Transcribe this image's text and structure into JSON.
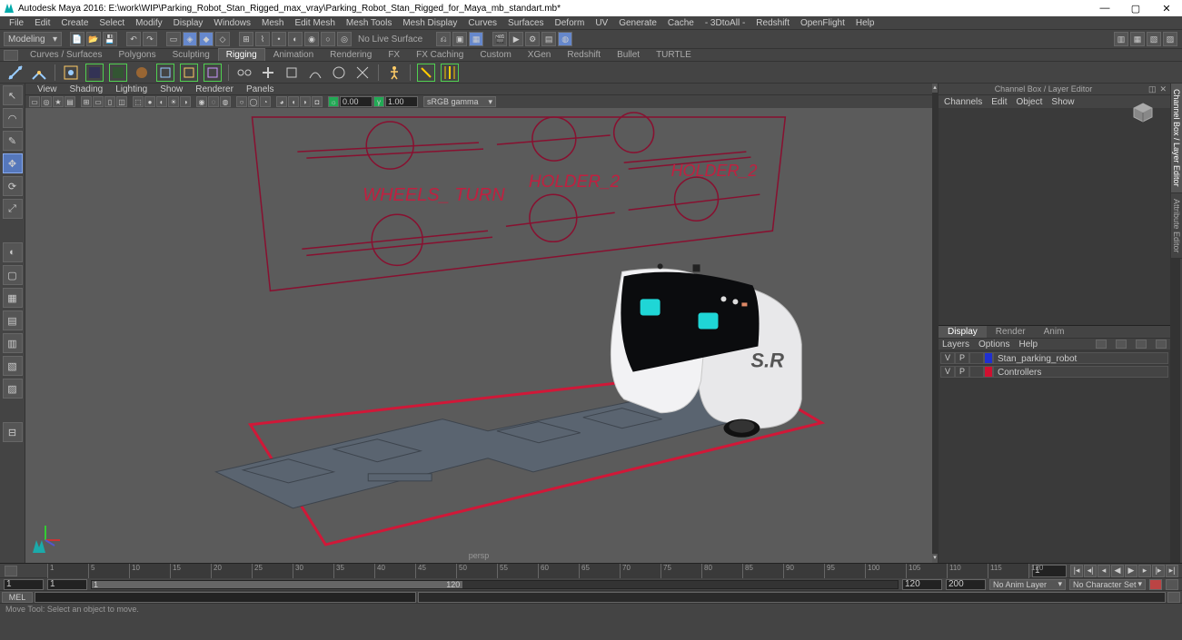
{
  "app": {
    "title": "Autodesk Maya 2016: E:\\work\\WIP\\Parking_Robot_Stan_Rigged_max_vray\\Parking_Robot_Stan_Rigged_for_Maya_mb_standart.mb*"
  },
  "mainmenu": [
    "File",
    "Edit",
    "Create",
    "Select",
    "Modify",
    "Display",
    "Windows",
    "Mesh",
    "Edit Mesh",
    "Mesh Tools",
    "Mesh Display",
    "Curves",
    "Surfaces",
    "Deform",
    "UV",
    "Generate",
    "Cache",
    "- 3DtoAll -",
    "Redshift",
    "OpenFlight",
    "Help"
  ],
  "workspace": {
    "selected": "Modeling"
  },
  "statusline": {
    "no_live_surface": "No Live Surface"
  },
  "shelf_tabs": [
    "Curves / Surfaces",
    "Polygons",
    "Sculpting",
    "Rigging",
    "Animation",
    "Rendering",
    "FX",
    "FX Caching",
    "Custom",
    "XGen",
    "Redshift",
    "Bullet",
    "TURTLE"
  ],
  "shelf_active": "Rigging",
  "view": {
    "menus": [
      "View",
      "Shading",
      "Lighting",
      "Show",
      "Renderer",
      "Panels"
    ],
    "exposure": "0.00",
    "gamma": "1.00",
    "colorspace": "sRGB gamma",
    "camera": "persp"
  },
  "rig_labels": {
    "wheels": "WHEELS_ TURN",
    "holder1": "HOLDER_2",
    "holder2": "HOLDER_2"
  },
  "robot_logo": "S.R",
  "channel": {
    "panel_title": "Channel Box / Layer Editor",
    "menus": [
      "Channels",
      "Edit",
      "Object",
      "Show"
    ]
  },
  "layer": {
    "tabs": [
      "Display",
      "Render",
      "Anim"
    ],
    "active": "Display",
    "menus": [
      "Layers",
      "Options",
      "Help"
    ],
    "rows": [
      {
        "vis": "V",
        "play": "P",
        "color": "#2030d0",
        "name": "Stan_parking_robot"
      },
      {
        "vis": "V",
        "play": "P",
        "color": "#d01030",
        "name": "Controllers"
      }
    ]
  },
  "side_tabs": [
    "Channel Box / Layer Editor",
    "Attribute Editor"
  ],
  "timeline": {
    "current": "1",
    "ticks": [
      "1",
      "5",
      "10",
      "15",
      "20",
      "25",
      "30",
      "35",
      "40",
      "45",
      "50",
      "55",
      "60",
      "65",
      "70",
      "75",
      "80",
      "85",
      "90",
      "95",
      "100",
      "105",
      "110",
      "115",
      "120"
    ]
  },
  "range": {
    "start_outer": "1",
    "start_inner": "1",
    "end_inner": "120",
    "end_outer": "120",
    "fps_or_len": "200",
    "anim_layer": "No Anim Layer",
    "char_set": "No Character Set"
  },
  "cmd": {
    "lang": "MEL"
  },
  "helpline": "Move Tool: Select an object to move."
}
